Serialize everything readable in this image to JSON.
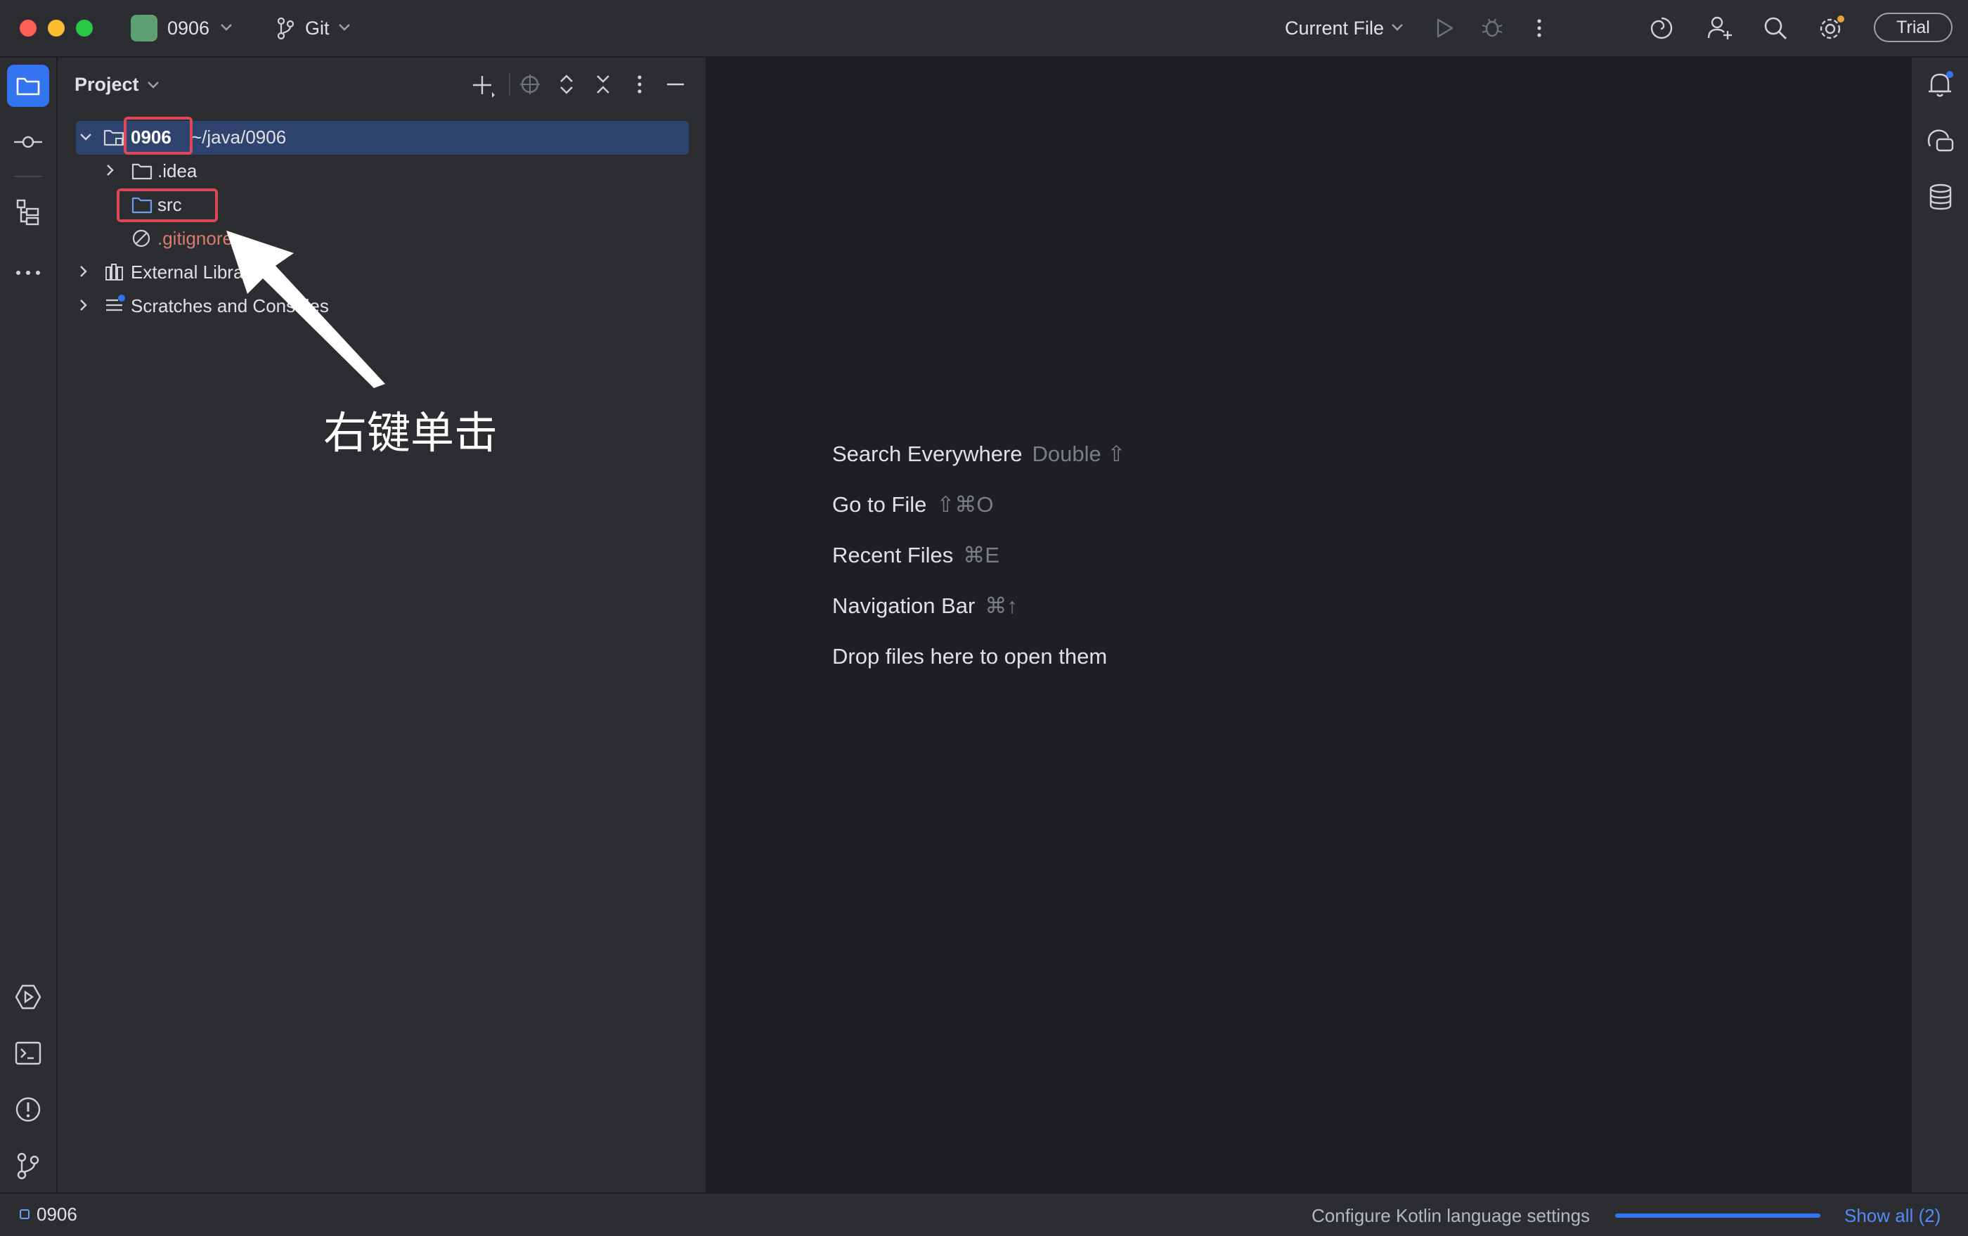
{
  "titlebar": {
    "project_name": "0906",
    "vcs_label": "Git",
    "run_config": "Current File",
    "trial_label": "Trial"
  },
  "project_panel": {
    "title": "Project",
    "tree": [
      {
        "label": "0906",
        "path": "~/java/0906"
      },
      {
        "label": ".idea"
      },
      {
        "label": "src"
      },
      {
        "label": ".gitignore"
      },
      {
        "label": "External Libraries"
      },
      {
        "label": "Scratches and Consoles"
      }
    ]
  },
  "annotation": {
    "label": "右键单击"
  },
  "editor_hints": [
    {
      "label": "Search Everywhere",
      "key": "Double ⇧"
    },
    {
      "label": "Go to File",
      "key": "⇧⌘O"
    },
    {
      "label": "Recent Files",
      "key": "⌘E"
    },
    {
      "label": "Navigation Bar",
      "key": "⌘↑"
    },
    {
      "label": "Drop files here to open them",
      "key": ""
    }
  ],
  "statusbar": {
    "project_label": "0906",
    "message": "Configure Kotlin language settings",
    "show_all": "Show all (2)",
    "progress_fraction": 1.0
  },
  "colors": {
    "accent": "#3574f0",
    "selection": "#2e436e",
    "highlight_box": "#e0465a",
    "ignored_file": "#d97c6b"
  }
}
